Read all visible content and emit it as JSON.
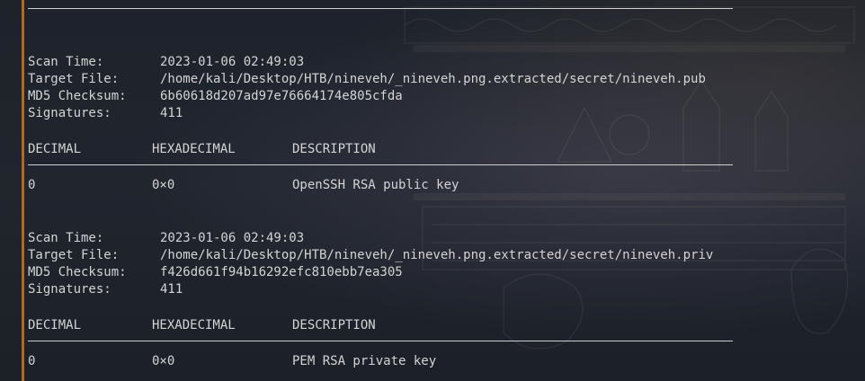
{
  "block1": {
    "scan_time_label": "Scan Time:",
    "scan_time_value": "2023-01-06 02:49:03",
    "target_file_label": "Target File:",
    "target_file_value": "/home/kali/Desktop/HTB/nineveh/_nineveh.png.extracted/secret/nineveh.pub",
    "md5_label": "MD5 Checksum:",
    "md5_value": "6b60618d207ad97e76664174e805cfda",
    "signatures_label": "Signatures:",
    "signatures_value": "411",
    "headers": [
      "DECIMAL",
      "HEXADECIMAL",
      "DESCRIPTION"
    ],
    "row": [
      "0",
      "0×0",
      "OpenSSH RSA public key"
    ]
  },
  "block2": {
    "scan_time_label": "Scan Time:",
    "scan_time_value": "2023-01-06 02:49:03",
    "target_file_label": "Target File:",
    "target_file_value": "/home/kali/Desktop/HTB/nineveh/_nineveh.png.extracted/secret/nineveh.priv",
    "md5_label": "MD5 Checksum:",
    "md5_value": "f426d661f94b16292efc810ebb7ea305",
    "signatures_label": "Signatures:",
    "signatures_value": "411",
    "headers": [
      "DECIMAL",
      "HEXADECIMAL",
      "DESCRIPTION"
    ],
    "row": [
      "0",
      "0×0",
      "PEM RSA private key"
    ]
  },
  "colors": {
    "prompt_bar": "#b46a1e",
    "text": "#d4d4d4",
    "background": "#1d222b"
  }
}
